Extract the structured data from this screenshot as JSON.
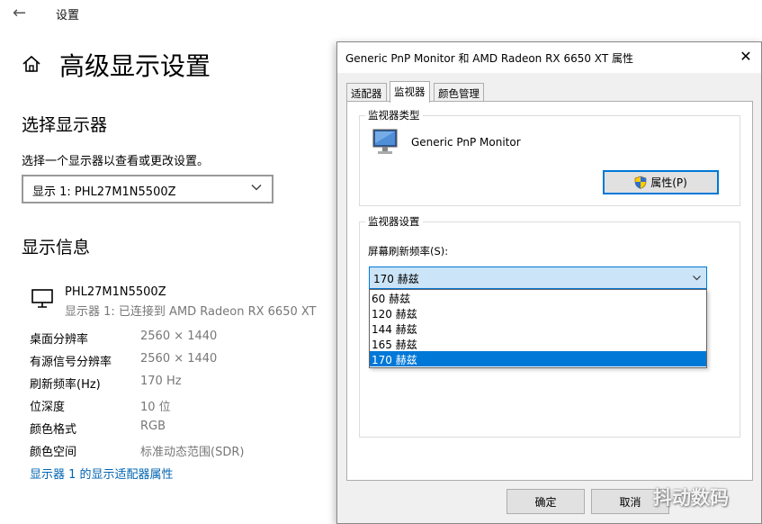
{
  "settings": {
    "app_title": "设置",
    "page_title": "高级显示设置",
    "select_section_title": "选择显示器",
    "select_hint": "选择一个显示器以查看或更改设置。",
    "display_select_value": "显示 1: PHL27M1N5500Z",
    "info_section_title": "显示信息",
    "monitor_name": "PHL27M1N5500Z",
    "monitor_sub": "显示器 1: 已连接到 AMD Radeon RX 6650 XT",
    "info_rows": [
      {
        "key": "桌面分辨率",
        "value": "2560 × 1440"
      },
      {
        "key": "有源信号分辨率",
        "value": "2560 × 1440"
      },
      {
        "key": "刷新频率(Hz)",
        "value": "170 Hz"
      },
      {
        "key": "位深度",
        "value": "10 位"
      },
      {
        "key": "颜色格式",
        "value": "RGB"
      },
      {
        "key": "颜色空间",
        "value": "标准动态范围(SDR)"
      }
    ],
    "adapter_link": "显示器 1 的显示适配器属性"
  },
  "dialog": {
    "title": "Generic PnP Monitor 和 AMD Radeon RX 6650 XT 属性",
    "tabs": [
      {
        "label": "适配器",
        "active": false
      },
      {
        "label": "监视器",
        "active": true
      },
      {
        "label": "颜色管理",
        "active": false
      }
    ],
    "monitor_type_group": "监视器类型",
    "monitor_type_name": "Generic PnP Monitor",
    "properties_button": "属性(P)",
    "monitor_settings_group": "监视器设置",
    "refresh_label": "屏幕刷新频率(S):",
    "refresh_selected": "170 赫兹",
    "refresh_options": [
      "60 赫兹",
      "120 赫兹",
      "144 赫兹",
      "165 赫兹",
      "170 赫兹"
    ],
    "ok_button": "确定",
    "cancel_button": "取消"
  },
  "watermark": "抖动数码",
  "colors": {
    "accent": "#0078d7",
    "link": "#0063b1",
    "selection_bg": "#cce4f7",
    "muted_text": "#777777"
  }
}
